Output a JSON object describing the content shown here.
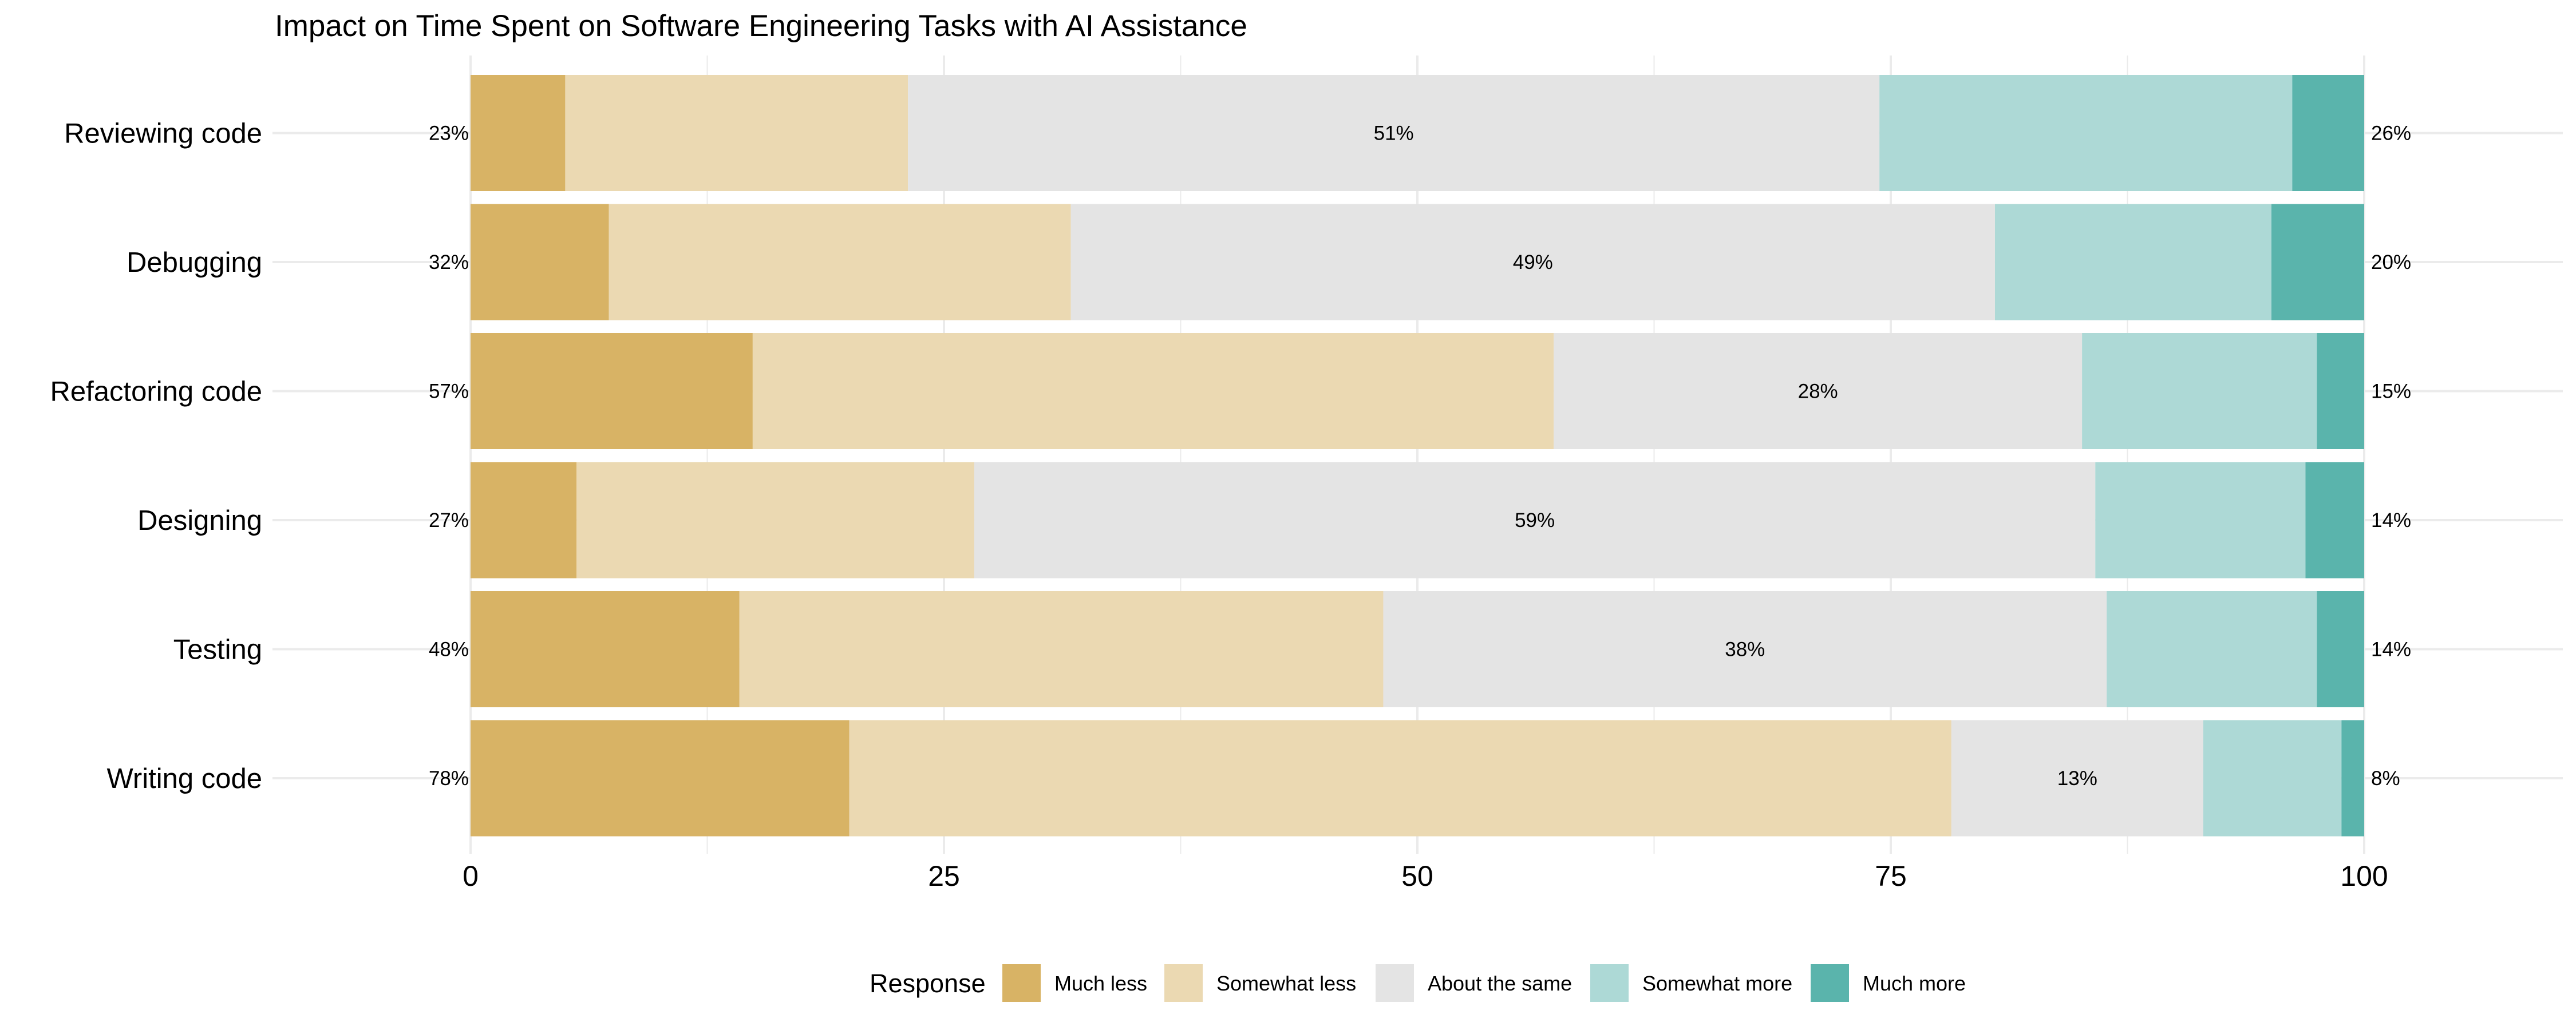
{
  "chart_data": {
    "type": "bar",
    "orientation": "horizontal",
    "stacked": true,
    "title": "Impact on Time Spent on Software Engineering Tasks with AI Assistance",
    "xlabel": "",
    "ylabel": "",
    "xlim": [
      0,
      100
    ],
    "x_ticks": [
      "0",
      "25",
      "50",
      "75",
      "100"
    ],
    "x_tick_values": [
      0,
      25,
      50,
      75,
      100
    ],
    "grid": true,
    "categories": [
      "Reviewing code",
      "Debugging",
      "Refactoring code",
      "Designing",
      "Testing",
      "Writing code"
    ],
    "series": [
      {
        "name": "Much less",
        "color": "#D8B365",
        "values": [
          5.0,
          7.3,
          14.9,
          5.6,
          14.2,
          20.0
        ]
      },
      {
        "name": "Somewhat less",
        "color": "#EBD9B2",
        "values": [
          18.1,
          24.4,
          42.3,
          21.0,
          34.0,
          58.2
        ]
      },
      {
        "name": "About the same",
        "color": "#E4E4E4",
        "values": [
          51.3,
          48.8,
          27.9,
          59.2,
          38.2,
          13.3
        ]
      },
      {
        "name": "Somewhat more",
        "color": "#ADD9D6",
        "values": [
          21.8,
          14.6,
          12.4,
          11.1,
          11.1,
          7.3
        ]
      },
      {
        "name": "Much more",
        "color": "#5AB4AC",
        "values": [
          3.8,
          4.9,
          2.5,
          3.1,
          2.5,
          1.2
        ]
      }
    ],
    "annotations": {
      "less_total": [
        "23%",
        "32%",
        "57%",
        "27%",
        "48%",
        "78%"
      ],
      "same": [
        "51%",
        "49%",
        "28%",
        "59%",
        "38%",
        "13%"
      ],
      "more_total": [
        "26%",
        "20%",
        "15%",
        "14%",
        "14%",
        "8%"
      ]
    },
    "legend": {
      "title": "Response",
      "position": "bottom",
      "items": [
        "Much less",
        "Somewhat less",
        "About the same",
        "Somewhat more",
        "Much more"
      ]
    }
  }
}
